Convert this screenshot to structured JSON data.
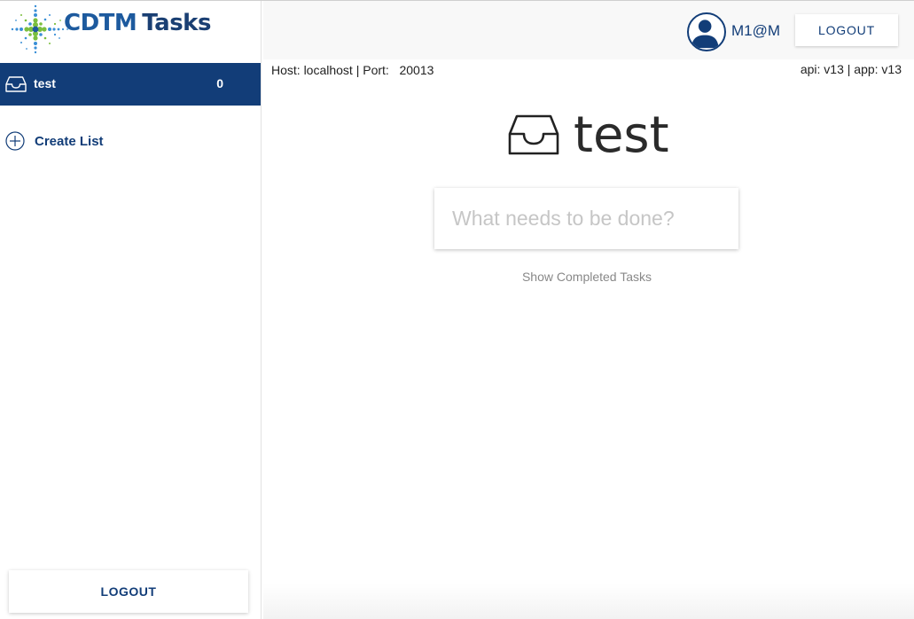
{
  "brand": {
    "name": "CDTM",
    "app": "Tasks",
    "colors": {
      "primary": "#123d78",
      "accent_green": "#7bbf3e",
      "accent_blue": "#3a8fd6"
    }
  },
  "sidebar": {
    "lists": [
      {
        "icon": "inbox-icon",
        "name": "test",
        "count": "0",
        "selected": true
      }
    ],
    "create_list_label": "Create List",
    "logout_label": "LOGOUT"
  },
  "header": {
    "username": "M1@M",
    "logout_label": "LOGOUT",
    "host_line": "Host: localhost | Port:   20013",
    "version_line": "api: v13 | app: v13"
  },
  "main": {
    "list_title": "test",
    "new_task_placeholder": "What needs to be done?",
    "show_completed_label": "Show Completed Tasks"
  }
}
